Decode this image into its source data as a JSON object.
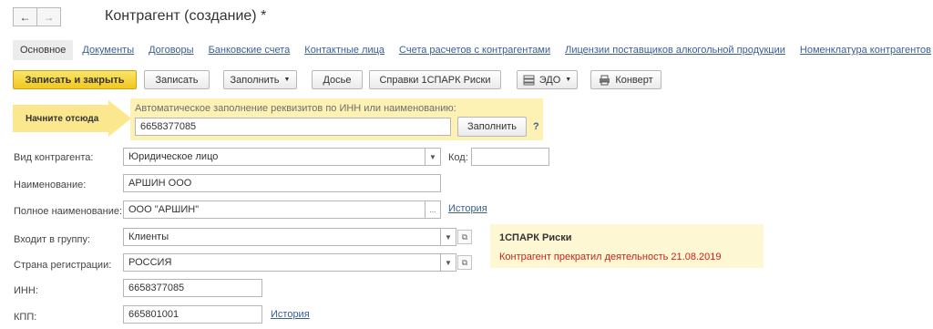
{
  "window": {
    "title": "Контрагент (создание) *",
    "back_icon": "←",
    "forward_icon": "→"
  },
  "tabs": [
    {
      "label": "Основное",
      "active": true
    },
    {
      "label": "Документы"
    },
    {
      "label": "Договоры"
    },
    {
      "label": "Банковские счета"
    },
    {
      "label": "Контактные лица"
    },
    {
      "label": "Счета расчетов с контрагентами"
    },
    {
      "label": "Лицензии поставщиков алкогольной продукции"
    },
    {
      "label": "Номенклатура контрагентов"
    }
  ],
  "toolbar": {
    "save_close": "Записать и закрыть",
    "save": "Записать",
    "fill": "Заполнить",
    "dossier": "Досье",
    "spark_reports": "Справки 1СПАРК Риски",
    "edo": "ЭДО",
    "envelope": "Конверт"
  },
  "hint": {
    "start_here": "Начните отсюда"
  },
  "autofill": {
    "label": "Автоматическое заполнение реквизитов по ИНН или наименованию:",
    "value": "6658377085",
    "button": "Заполнить",
    "help": "?"
  },
  "form": {
    "kind_label": "Вид контрагента:",
    "kind_value": "Юридическое лицо",
    "code_label": "Код:",
    "code_value": "",
    "name_label": "Наименование:",
    "name_value": "АРШИН ООО",
    "full_name_label": "Полное наименование:",
    "full_name_value": "ООО \"АРШИН\"",
    "full_name_history": "История",
    "group_label": "Входит в группу:",
    "group_value": "Клиенты",
    "country_label": "Страна регистрации:",
    "country_value": "РОССИЯ",
    "inn_label": "ИНН:",
    "inn_value": "6658377085",
    "kpp_label": "КПП:",
    "kpp_value": "665801001",
    "kpp_history": "История"
  },
  "spark": {
    "title": "1СПАРК Риски",
    "message": "Контрагент прекратил деятельность 21.08.2019"
  },
  "colors": {
    "primary_button": "#f0c91c",
    "autofill_background": "#fdf2b4",
    "spark_background": "#fdf7d4",
    "warning_text": "#c9221a",
    "link": "#3b5e94"
  }
}
